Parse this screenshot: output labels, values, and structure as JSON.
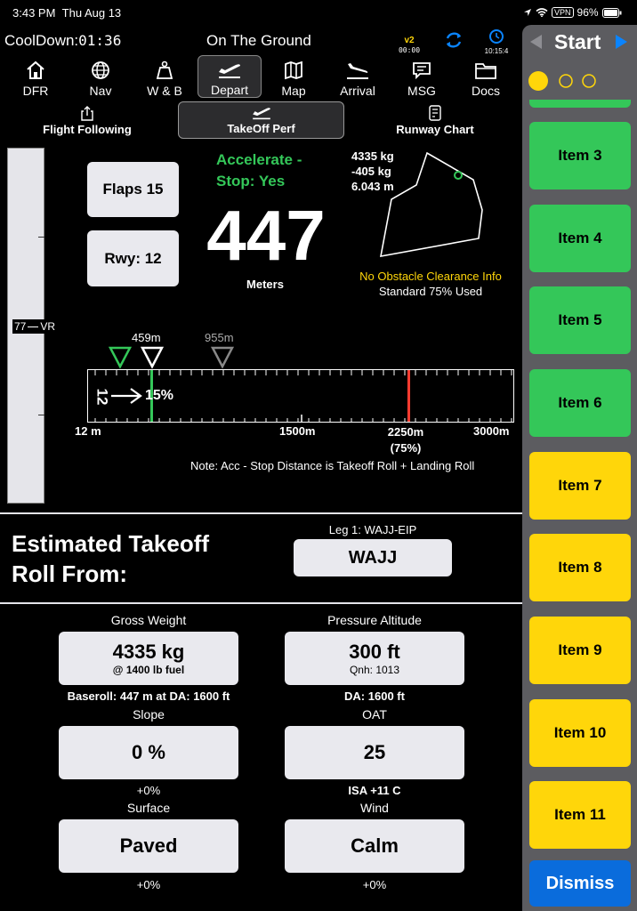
{
  "status_bar": {
    "time": "3:43 PM",
    "date": "Thu Aug 13",
    "vpn": "VPN",
    "battery": "96%"
  },
  "header": {
    "cooldown_label": "CoolDown:",
    "cooldown_value": "01:36",
    "title": "On The Ground",
    "version": "v2",
    "version_time": "00:00",
    "clock_time": "10:15:4"
  },
  "nav": [
    {
      "label": "DFR",
      "icon": "home-icon"
    },
    {
      "label": "Nav",
      "icon": "globe-icon"
    },
    {
      "label": "W & B",
      "icon": "weight-icon"
    },
    {
      "label": "Depart",
      "icon": "takeoff-icon",
      "active": true
    },
    {
      "label": "Map",
      "icon": "map-icon"
    },
    {
      "label": "Arrival",
      "icon": "landing-icon"
    },
    {
      "label": "MSG",
      "icon": "message-icon"
    },
    {
      "label": "Docs",
      "icon": "folder-icon"
    }
  ],
  "subtabs": [
    {
      "label": "Flight Following",
      "icon": "share-icon"
    },
    {
      "label": "TakeOff Perf",
      "icon": "takeoff-icon",
      "active": true
    },
    {
      "label": "Runway Chart",
      "icon": "chart-icon"
    }
  ],
  "perf": {
    "flaps": "Flaps 15",
    "runway": "Rwy: 12",
    "accel_stop_line1": "Accelerate -",
    "accel_stop_line2": "Stop: Yes",
    "distance": "447",
    "distance_unit": "Meters",
    "weight_info_1": "4335 kg",
    "weight_info_2": "-405 kg",
    "weight_info_3": "6.043 m",
    "obstacle_note": "No Obstacle Clearance Info",
    "standard_note": "Standard 75% Used",
    "vr_speed": "77",
    "vr_label": "VR"
  },
  "runway_bar": {
    "marker1_label": "459m",
    "marker2_label": "955m",
    "runway_id": "12",
    "slope": "15%",
    "start_label": "12 m",
    "mid_label": "1500m",
    "limit_label": "2250m",
    "limit_pct": "(75%)",
    "end_label": "3000m",
    "note": "Note: Acc - Stop Distance is Takeoff Roll + Landing Roll"
  },
  "estimate": {
    "title_line1": "Estimated Takeoff",
    "title_line2": "Roll From:",
    "leg_label": "Leg 1: WAJJ-EIP",
    "airport": "WAJJ"
  },
  "params": {
    "gross_weight_label": "Gross Weight",
    "gross_weight_value": "4335 kg",
    "gross_weight_sub": "@ 1400 lb fuel",
    "baseroll": "Baseroll: 447 m at DA: 1600 ft",
    "pressure_alt_label": "Pressure Altitude",
    "pressure_alt_value": "300 ft",
    "pressure_alt_sub": "Qnh: 1013",
    "da": "DA: 1600 ft",
    "slope_label": "Slope",
    "slope_value": "0 %",
    "slope_sub": "+0%",
    "oat_label": "OAT",
    "oat_value": "25",
    "oat_sub": "ISA +11 C",
    "surface_label": "Surface",
    "surface_value": "Paved",
    "surface_sub": "+0%",
    "wind_label": "Wind",
    "wind_value": "Calm",
    "wind_sub": "+0%"
  },
  "sidebar": {
    "start": "Start",
    "items": [
      "Item 3",
      "Item 4",
      "Item 5",
      "Item 6",
      "Item 7",
      "Item 8",
      "Item 9",
      "Item 10",
      "Item 11"
    ],
    "dismiss": "Dismiss"
  },
  "colors": {
    "green": "#34c759",
    "yellow": "#ffd60a",
    "accent_blue": "#0a84ff",
    "warning": "#ffd60a",
    "limit_red": "#ff3b30"
  }
}
